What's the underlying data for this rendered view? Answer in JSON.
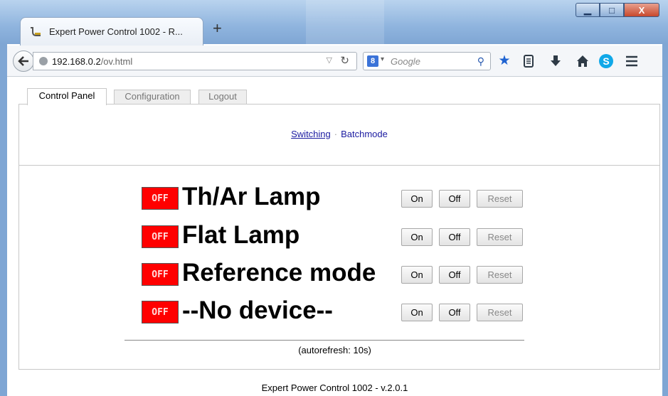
{
  "browser": {
    "tab_title": "Expert Power Control 1002 - R...",
    "new_tab_glyph": "+",
    "window_controls": {
      "minimize": "▁",
      "maximize": "□",
      "close": "X"
    },
    "url_host": "192.168.0.2",
    "url_path": "/ov.html",
    "search_placeholder": "Google",
    "search_engine_badge": "8",
    "toolbar_icons": [
      "star-icon",
      "reading-list-icon",
      "download-icon",
      "home-icon",
      "skype-icon",
      "menu-icon"
    ]
  },
  "page_tabs": [
    {
      "label": "Control Panel",
      "active": true
    },
    {
      "label": "Configuration",
      "active": false
    },
    {
      "label": "Logout",
      "active": false
    }
  ],
  "subnav": {
    "switching": "Switching",
    "separator": "·",
    "batchmode": "Batchmode"
  },
  "outlets": [
    {
      "status": "OFF",
      "name": "Th/Ar Lamp",
      "on_label": "On",
      "off_label": "Off",
      "reset_label": "Reset"
    },
    {
      "status": "OFF",
      "name": "Flat Lamp",
      "on_label": "On",
      "off_label": "Off",
      "reset_label": "Reset"
    },
    {
      "status": "OFF",
      "name": "Reference mode",
      "on_label": "On",
      "off_label": "Off",
      "reset_label": "Reset"
    },
    {
      "status": "OFF",
      "name": "--No device--",
      "on_label": "On",
      "off_label": "Off",
      "reset_label": "Reset"
    }
  ],
  "autorefresh": "(autorefresh: 10s)",
  "footer": "Expert Power Control 1002 - v.2.0.1",
  "colors": {
    "status_off": "#ff0000",
    "link": "#1a1aa0"
  }
}
